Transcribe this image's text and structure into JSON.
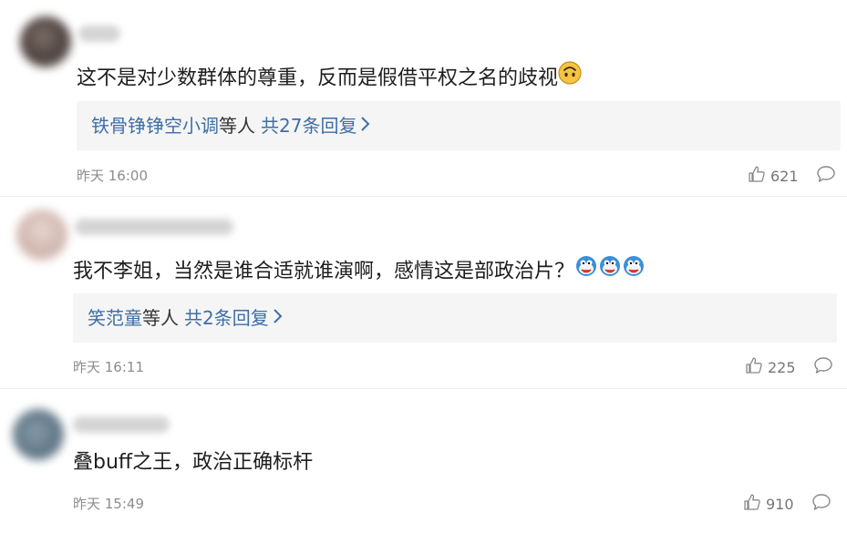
{
  "comments": [
    {
      "avatar_color": "#5b4f4b",
      "text": "这不是对少数群体的尊重，反而是假借平权之名的歧视",
      "emoji": "upside-down-face-icon",
      "reply_users": "铁骨铮铮空小调",
      "reply_mid": "等人",
      "reply_count": "共27条回复",
      "time": "昨天 16:00",
      "likes": "621"
    },
    {
      "avatar_color": "#d7c3bd",
      "text": "我不李姐，当然是谁合适就谁演啊，感情这是部政治片？",
      "emoji": "doge-icon",
      "reply_users": "笑范童",
      "reply_mid": "等人",
      "reply_count": "共2条回复",
      "time": "昨天 16:11",
      "likes": "225"
    },
    {
      "avatar_color": "#6f8696",
      "text": "叠buff之王，政治正确标杆",
      "time": "昨天 15:49",
      "likes": "910"
    }
  ]
}
